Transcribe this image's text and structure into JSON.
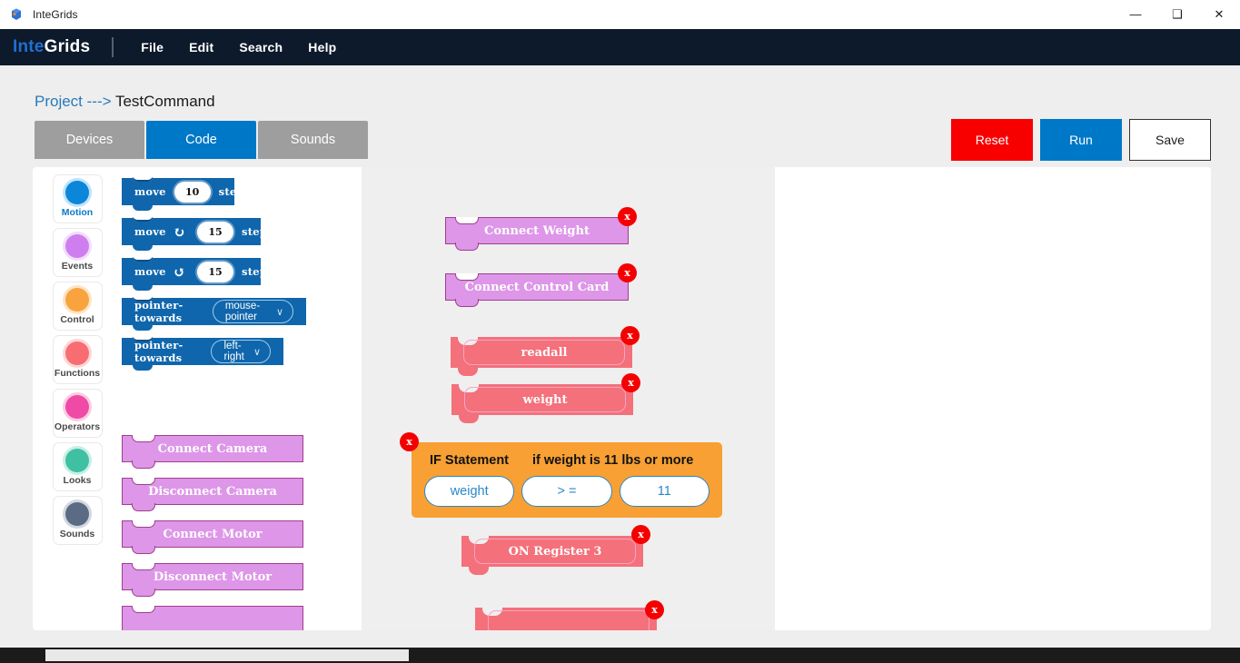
{
  "window": {
    "title": "InteGrids",
    "icon": "app-icon",
    "minimize": "—",
    "maximize": "❑",
    "close": "✕"
  },
  "menubar": {
    "brand_part1": "Inte",
    "brand_part2": "Grids",
    "items": [
      "File",
      "Edit",
      "Search",
      "Help"
    ]
  },
  "breadcrumb": {
    "lead": "Project --->",
    "current": "TestCommand"
  },
  "tabs": [
    {
      "label": "Devices",
      "active": false
    },
    {
      "label": "Code",
      "active": true
    },
    {
      "label": "Sounds",
      "active": false
    }
  ],
  "actions": [
    {
      "label": "Reset",
      "color": "#f80000"
    },
    {
      "label": "Run",
      "color": "#0078c8"
    },
    {
      "label": "Save",
      "color": "#ffffff"
    }
  ],
  "categories": [
    {
      "label": "Motion",
      "color": "#0b86d8",
      "active": true
    },
    {
      "label": "Events",
      "color": "#cf7ef0",
      "active": false
    },
    {
      "label": "Control",
      "color": "#f9a33f",
      "active": false
    },
    {
      "label": "Functions",
      "color": "#f76d72",
      "active": false
    },
    {
      "label": "Operators",
      "color": "#ef4aa5",
      "active": false
    },
    {
      "label": "Looks",
      "color": "#3fc0a2",
      "active": false
    },
    {
      "label": "Sounds",
      "color": "#5c6b84",
      "active": false
    }
  ],
  "palette": {
    "motion_blocks": [
      {
        "pre": "move",
        "icon": "",
        "value": "10",
        "post": "steps"
      },
      {
        "pre": "move",
        "icon": "↻",
        "value": "15",
        "post": "steps"
      },
      {
        "pre": "move",
        "icon": "↺",
        "value": "15",
        "post": "steps"
      }
    ],
    "pointer_blocks": [
      {
        "pre": "pointer-towards",
        "option": "mouse-pointer",
        "chevron": "∨"
      },
      {
        "pre": "pointer-towards",
        "option": "left-right",
        "chevron": "∨"
      }
    ],
    "device_blocks": [
      {
        "label": "Connect Camera"
      },
      {
        "label": "Disconnect Camera"
      },
      {
        "label": "Connect Motor"
      },
      {
        "label": "Disconnect Motor"
      }
    ]
  },
  "canvas": {
    "purple_blocks": [
      {
        "label": "Connect Weight",
        "close": "x"
      },
      {
        "label": "Connect Control Card",
        "close": "x"
      }
    ],
    "red_blocks": [
      {
        "label": "readall",
        "close": "x"
      },
      {
        "label": "weight",
        "close": "x"
      },
      {
        "label": "ON Register 3",
        "close": "x"
      }
    ],
    "if_block": {
      "close": "x",
      "title": "IF Statement",
      "description": "if weight is 11 lbs or more",
      "fields": [
        {
          "name": "variable",
          "value": "weight"
        },
        {
          "name": "operator",
          "value": "> ="
        },
        {
          "name": "threshold",
          "value": "11"
        }
      ]
    }
  }
}
